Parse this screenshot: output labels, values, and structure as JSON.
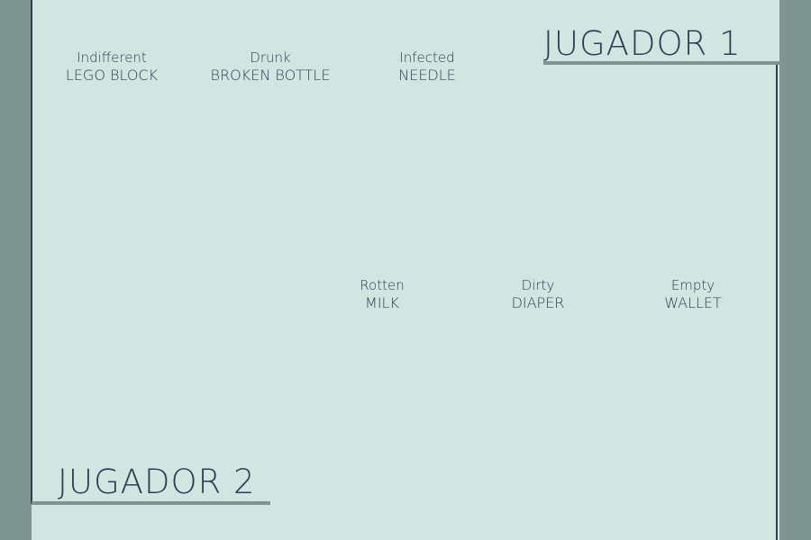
{
  "players": {
    "player1_label": "JUGADOR 1",
    "player2_label": "JUGADOR 2"
  },
  "cards": [
    {
      "adjective": "Indifferent",
      "name": "LEGO BLOCK"
    },
    {
      "adjective": "Drunk",
      "name": "BROKEN BOTTLE"
    },
    {
      "adjective": "Infected",
      "name": "NEEDLE"
    },
    {
      "adjective": "Rotten",
      "name": "MILK"
    },
    {
      "adjective": "Dirty",
      "name": "DIAPER"
    },
    {
      "adjective": "Empty",
      "name": "WALLET"
    }
  ],
  "colors": {
    "frame": "#7f9690",
    "board": "#d2e5e0",
    "ink": "#2d3c57"
  }
}
